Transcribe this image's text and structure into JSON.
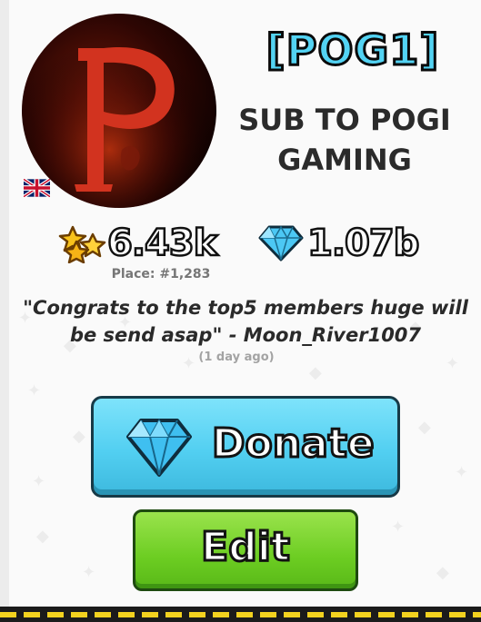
{
  "clan": {
    "tag": "[POG1]",
    "name": "SUB TO POGI GAMING",
    "flag_icon": "uk-flag-icon",
    "avatar_letter": "P"
  },
  "stats": {
    "stars_value": "6.43k",
    "stars_icon": "stars-icon",
    "diamonds_value": "1.07b",
    "diamonds_icon": "diamond-icon",
    "place": "Place: #1,283"
  },
  "message": {
    "text": "\"Congrats to the top5 members huge will be send asap\" - Moon_River1007",
    "time": "(1 day ago)"
  },
  "buttons": {
    "donate_label": "Donate",
    "edit_label": "Edit"
  },
  "colors": {
    "clan_tag": "#53d3f3",
    "donate_button": "#52cff1",
    "edit_button": "#6ccd22",
    "stripe": "#f3d21f"
  }
}
